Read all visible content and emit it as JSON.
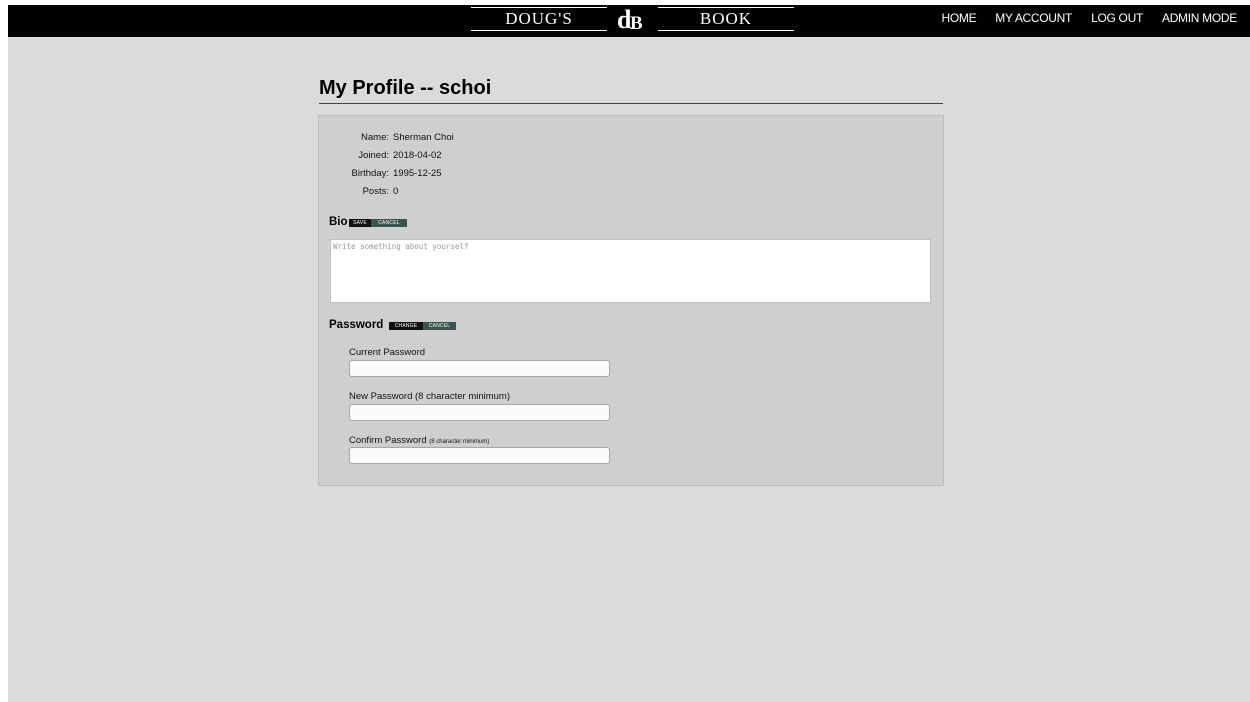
{
  "header": {
    "logo_left": "DOUG'S",
    "logo_mark_d": "d",
    "logo_mark_b": "B",
    "logo_right": "BOOK",
    "nav": {
      "home": "HOME",
      "my_account": "MY ACCOUNT",
      "log_out": "LOG OUT",
      "admin_mode": "ADMIN MODE"
    }
  },
  "page": {
    "title": "My Profile -- schoi"
  },
  "profile": {
    "name_label": "Name:",
    "name_value": "Sherman Choi",
    "joined_label": "Joined:",
    "joined_value": "2018-04-02",
    "birthday_label": "Birthday:",
    "birthday_value": "1995-12-25",
    "posts_label": "Posts:",
    "posts_value": "0"
  },
  "bio": {
    "title": "Bio",
    "save_label": "SAVE",
    "cancel_label": "CANCEL",
    "placeholder": "Write something about yourself",
    "value": ""
  },
  "password": {
    "title": "Password",
    "change_label": "CHANGE",
    "cancel_label": "CANCEL",
    "current_label": "Current Password",
    "new_label": "New Password (8 character minimum)",
    "confirm_label_main": "Confirm Password",
    "confirm_label_note": "(8 character minimum)",
    "current_value": "",
    "new_value": "",
    "confirm_value": ""
  },
  "colors": {
    "background": "#dbdbdb",
    "topbar": "#000000",
    "panel": "#cfcfcf",
    "button_dark": "#111111",
    "button_teal": "#3a5450"
  }
}
